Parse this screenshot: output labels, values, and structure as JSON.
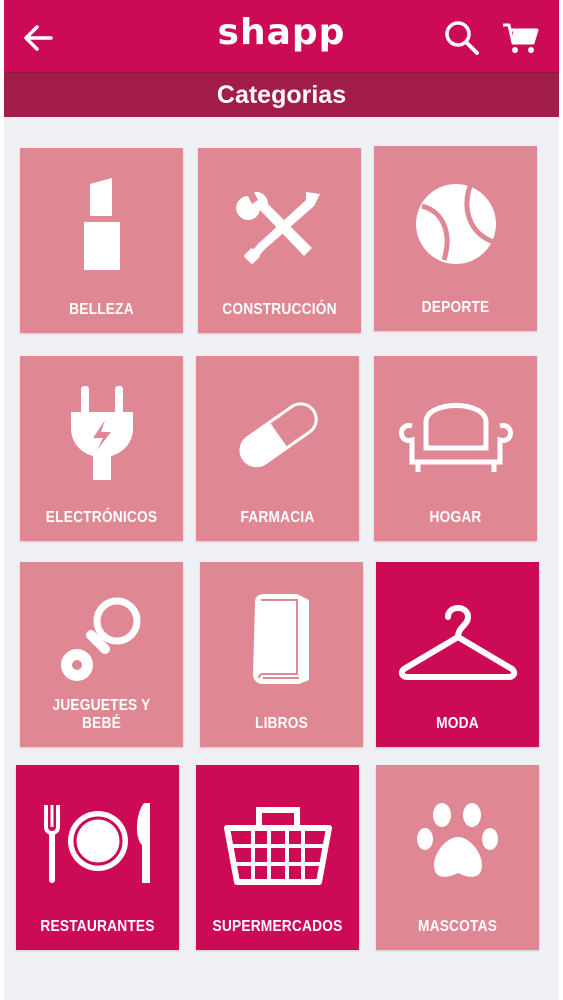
{
  "header": {
    "brand": "shapp",
    "section_title": "Categorias"
  },
  "icons": {
    "back": "arrow-left-icon",
    "search": "search-icon",
    "cart": "shopping-cart-icon"
  },
  "colors": {
    "primary": "#cc0a55",
    "secondary_bar": "#a31d4b",
    "tile": "#df8793",
    "tile_active": "#cc0a55",
    "background": "#eef0f4"
  },
  "categories": [
    {
      "label": "BELLEZA",
      "icon": "lipstick-icon",
      "active": false
    },
    {
      "label": "CONSTRUCCIÓN",
      "icon": "wrench-screwdriver-icon",
      "active": false
    },
    {
      "label": "DEPORTE",
      "icon": "tennis-ball-icon",
      "active": false
    },
    {
      "label": "ELECTRÓNICOS",
      "icon": "power-plug-icon",
      "active": false
    },
    {
      "label": "FARMACIA",
      "icon": "pill-capsule-icon",
      "active": false
    },
    {
      "label": "HOGAR",
      "icon": "armchair-icon",
      "active": false
    },
    {
      "label": "JUEGUETES Y BEBÉ",
      "icon": "pacifier-icon",
      "active": false
    },
    {
      "label": "LIBROS",
      "icon": "book-icon",
      "active": false
    },
    {
      "label": "MODA",
      "icon": "clothes-hanger-icon",
      "active": true
    },
    {
      "label": "RESTAURANTES",
      "icon": "plate-cutlery-icon",
      "active": true
    },
    {
      "label": "SUPERMERCADOS",
      "icon": "shopping-basket-icon",
      "active": true
    },
    {
      "label": "MASCOTAS",
      "icon": "paw-print-icon",
      "active": false
    }
  ]
}
